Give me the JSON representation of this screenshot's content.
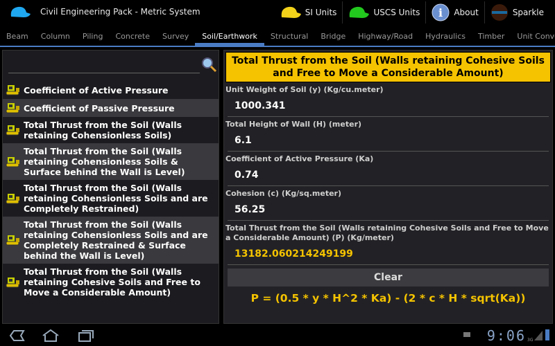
{
  "app": {
    "title": "Civil Engineering Pack - Metric System"
  },
  "actions": [
    {
      "label": "SI Units",
      "color": "#f2d21a"
    },
    {
      "label": "USCS Units",
      "color": "#22c81e"
    },
    {
      "label": "About"
    },
    {
      "label": "Sparkle"
    }
  ],
  "tabs": [
    "Beam",
    "Column",
    "Piling",
    "Concrete",
    "Survey",
    "Soil/Earthwork",
    "Structural",
    "Bridge",
    "Highway/Road",
    "Hydraulics",
    "Timber",
    "Unit Converter"
  ],
  "selected_tab": "Soil/Earthwork",
  "search": {
    "value": ""
  },
  "list": [
    "Coefficient of Active Pressure",
    "Coefficient of Passive Pressure",
    "Total Thrust from the Soil (Walls retaining Cohensionless Soils)",
    "Total Thrust from the Soil (Walls retaining Cohensionless Soils & Surface behind the Wall is Level)",
    "Total Thrust from the Soil (Walls retaining Cohensionless Soils and are Completely Restrained)",
    "Total Thrust from the Soil (Walls retaining Cohensionless Soils and are Completely Restrained & Surface behind the Wall is Level)",
    "Total Thrust from the Soil (Walls retaining Cohesive Soils and Free to Move a Considerable Amount)"
  ],
  "calc": {
    "title": "Total Thrust from the Soil (Walls retaining Cohesive Soils and Free to Move a Considerable Amount)",
    "fields": [
      {
        "label": "Unit Weight of Soil (y) (Kg/cu.meter)",
        "value": "1000.341"
      },
      {
        "label": "Total Height of Wall (H) (meter)",
        "value": "6.1"
      },
      {
        "label": "Coefficient of Active Pressure (Ka)",
        "value": "0.74"
      },
      {
        "label": "Cohesion (c) (Kg/sq.meter)",
        "value": "56.25"
      }
    ],
    "result_label": "Total Thrust from the Soil (Walls retaining Cohesive Soils and Free to Move a Considerable Amount) (P) (Kg/meter)",
    "result_value": "13182.060214249199",
    "clear_label": "Clear",
    "formula": "P = (0.5 * y * H^2 * Ka) - (2 * c * H * sqrt(Ka))"
  },
  "status": {
    "time": "9:06",
    "network": "3G"
  },
  "colors": {
    "accent": "#f5c300",
    "tab_indicator": "#4a7cc4"
  }
}
